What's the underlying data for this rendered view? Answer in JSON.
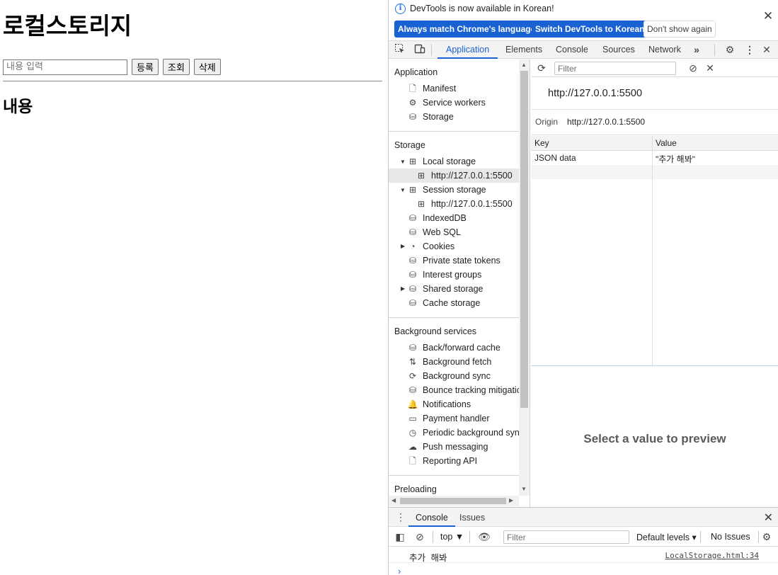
{
  "page": {
    "title": "로컬스토리지",
    "input_placeholder": "내용 입력",
    "buttons": {
      "register": "등록",
      "view": "조회",
      "delete": "삭제"
    },
    "content_heading": "내용"
  },
  "devtools": {
    "infobar": {
      "message": "DevTools is now available in Korean!",
      "always_match": "Always match Chrome's language",
      "switch_korean": "Switch DevTools to Korean",
      "dont_show": "Don't show again"
    },
    "tabs": [
      "Application",
      "Elements",
      "Console",
      "Sources",
      "Network"
    ],
    "active_tab": "Application",
    "sidebar": {
      "application_section": "Application",
      "application_items": [
        "Manifest",
        "Service workers",
        "Storage"
      ],
      "storage_section": "Storage",
      "local_storage": "Local storage",
      "local_storage_origin": "http://127.0.0.1:5500",
      "session_storage": "Session storage",
      "session_storage_origin": "http://127.0.0.1:5500",
      "storage_items": [
        "IndexedDB",
        "Web SQL",
        "Cookies",
        "Private state tokens",
        "Interest groups",
        "Shared storage",
        "Cache storage"
      ],
      "background_section": "Background services",
      "background_items": [
        "Back/forward cache",
        "Background fetch",
        "Background sync",
        "Bounce tracking mitigatic",
        "Notifications",
        "Payment handler",
        "Periodic background sync",
        "Push messaging",
        "Reporting API"
      ],
      "preloading_section": "Preloading"
    },
    "storage_panel": {
      "filter_placeholder": "Filter",
      "origin_title": "http://127.0.0.1:5500",
      "origin_label": "Origin",
      "origin_value": "http://127.0.0.1:5500",
      "columns": {
        "key": "Key",
        "value": "Value"
      },
      "rows": [
        {
          "key": "JSON data",
          "value": "\"추가 해봐\""
        }
      ],
      "preview_message": "Select a value to preview"
    },
    "drawer": {
      "tabs": [
        "Console",
        "Issues"
      ],
      "context": "top",
      "filter_placeholder": "Filter",
      "levels": "Default levels",
      "issues": "No Issues",
      "log_message": "추가 해봐",
      "log_source": "LocalStorage.html:34",
      "prompt": "›"
    }
  }
}
